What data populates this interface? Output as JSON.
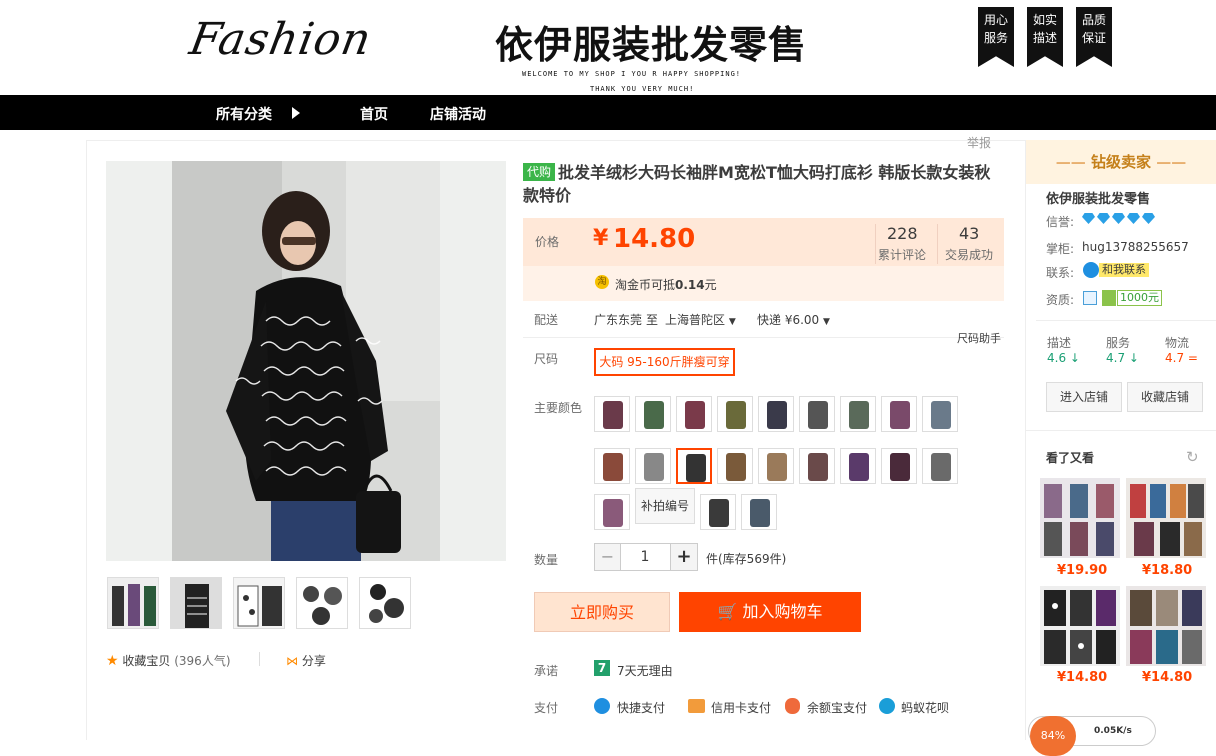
{
  "header": {
    "logo_text": "Fashion",
    "shop_title": "依伊服装批发零售",
    "welcome": "WELCOME TO MY SHOP I YOU R HAPPY SHOPPING!",
    "thanks": "THANK YOU VERY MUCH!",
    "badges": [
      "用心\n服务",
      "如实\n描述",
      "品质\n保证"
    ]
  },
  "nav": {
    "category": "所有分类",
    "home": "首页",
    "activity": "店铺活动"
  },
  "report": "举报",
  "gallery": {
    "favorite": "收藏宝贝",
    "favorite_count": "(396人气)",
    "share": "分享"
  },
  "product": {
    "tag": "代购",
    "title": "批发羊绒杉大码长袖胖M宽松T恤大码打底衫 韩版长款女装秋款特价",
    "price_label": "价格",
    "currency": "¥",
    "price": "14.80",
    "reviews_count": "228",
    "reviews_label": "累计评论",
    "sales_count": "43",
    "sales_label": "交易成功",
    "coin_text": "淘金币可抵",
    "coin_value": "0.14",
    "coin_unit": "元",
    "shipping_label": "配送",
    "from": "广东东莞",
    "to_word": "至",
    "to": "上海普陀区",
    "express": "快递 ¥6.00",
    "size_helper": "尺码助手",
    "size_label": "尺码",
    "size_value": "大码 95-160斤胖瘦可穿",
    "color_label": "主要颜色",
    "color_extra": "补拍编号",
    "qty_label": "数量",
    "qty_value": "1",
    "qty_minus": "−",
    "qty_plus": "+",
    "stock": "件(库存569件)",
    "buy_now": "立即购买",
    "add_cart": "加入购物车",
    "promise_label": "承诺",
    "promise_icon": "7",
    "promise": "7天无理由",
    "pay_label": "支付",
    "pay_methods": [
      "快捷支付",
      "信用卡支付",
      "余额宝支付",
      "蚂蚁花呗"
    ]
  },
  "seller": {
    "level": "钻级卖家",
    "name": "依伊服装批发零售",
    "credit_label": "信誉:",
    "owner_label": "掌柜:",
    "owner": "hug13788255657",
    "contact_label": "联系:",
    "contact": "和我联系",
    "qual_label": "资质:",
    "deposit": "1000元",
    "scores": [
      {
        "label": "描述",
        "value": "4.6",
        "arrow": "↓",
        "color": "#1a9f74"
      },
      {
        "label": "服务",
        "value": "4.7",
        "arrow": "↓",
        "color": "#1a9f74"
      },
      {
        "label": "物流",
        "value": "4.7",
        "arrow": "=",
        "color": "#ff4400"
      }
    ],
    "enter_shop": "进入店铺",
    "fav_shop": "收藏店铺"
  },
  "recommend": {
    "title": "看了又看",
    "prices": [
      "¥19.90",
      "¥18.80",
      "¥14.80",
      "¥14.80"
    ]
  },
  "float": {
    "percent": "84%",
    "speed": "0.05K/s"
  },
  "colors": {
    "accent": "#ff4400",
    "buy_bg": "#ffeded",
    "cart_bg": "#ff4400"
  }
}
